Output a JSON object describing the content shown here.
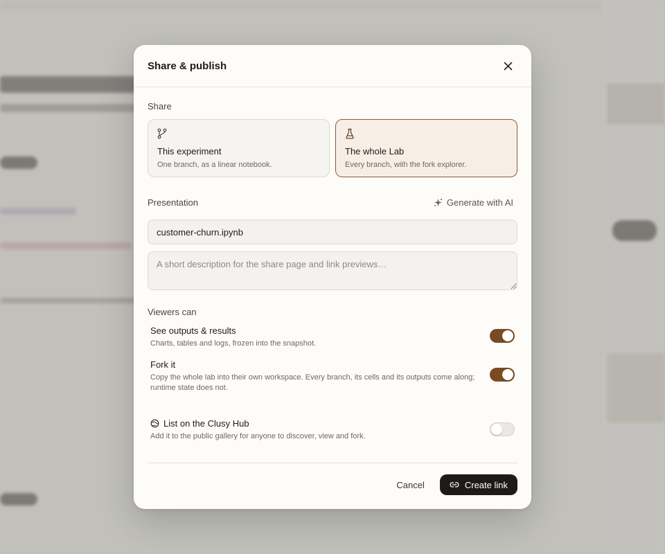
{
  "modal": {
    "title": "Share & publish",
    "share_label": "Share",
    "options": [
      {
        "icon": "branch-icon",
        "title": "This experiment",
        "subtitle": "One branch, as a linear notebook.",
        "selected": false
      },
      {
        "icon": "flask-icon",
        "title": "The whole Lab",
        "subtitle": "Every branch, with the fork explorer.",
        "selected": true
      }
    ],
    "presentation_label": "Presentation",
    "generate_ai_label": "Generate with AI",
    "filename_value": "customer-churn.ipynb",
    "description_placeholder": "A short description for the share page and link previews…",
    "viewers_label": "Viewers can",
    "permissions": [
      {
        "title": "See outputs & results",
        "desc": "Charts, tables and logs, frozen into the snapshot.",
        "enabled": true
      },
      {
        "title": "Fork it",
        "desc": "Copy the whole lab into their own workspace. Every branch, its cells and its outputs come along; runtime state does not.",
        "enabled": true
      },
      {
        "title": "List on the Clusy Hub",
        "desc": "Add it to the public gallery for anyone to discover, view and fork.",
        "enabled": false,
        "icon": "globe-icon"
      }
    ],
    "cancel_label": "Cancel",
    "create_label": "Create link"
  },
  "colors": {
    "accent": "#7a4a22",
    "selected_border": "#8b5a35",
    "primary_button": "#1e1a17"
  }
}
